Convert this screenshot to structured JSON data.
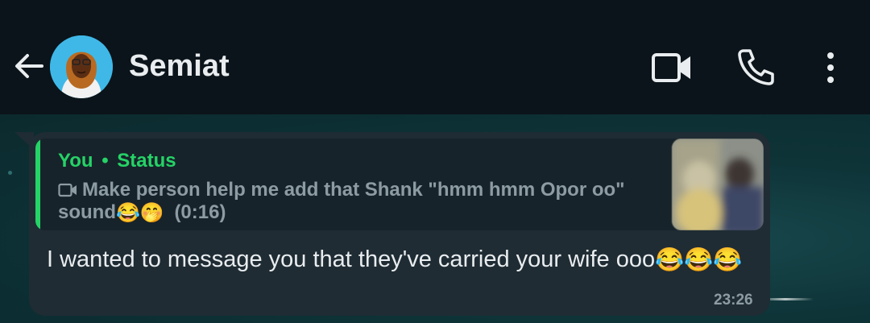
{
  "header": {
    "contact_name": "Semiat",
    "back_icon": "arrow-left-icon",
    "video_icon": "video-call-icon",
    "call_icon": "phone-icon",
    "menu_icon": "more-vert-icon"
  },
  "message": {
    "quote": {
      "author": "You",
      "separator": "•",
      "source": "Status",
      "media_icon": "video-icon",
      "caption_line1": "Make person help me add that Shank \"hmm hmm Opor oo\"",
      "caption_line2_text": "sound",
      "caption_emojis": "😂🤭",
      "duration": "(0:16)"
    },
    "text": "I wanted to message you that they've carried your wife ooo",
    "text_emojis": "😂😂😂",
    "time": "23:26"
  },
  "colors": {
    "header_bg": "#0b141a",
    "bubble_bg": "#1f2c34",
    "accent_green": "#25d366",
    "text_primary": "#e9edef",
    "text_secondary": "#8d9ba3"
  }
}
